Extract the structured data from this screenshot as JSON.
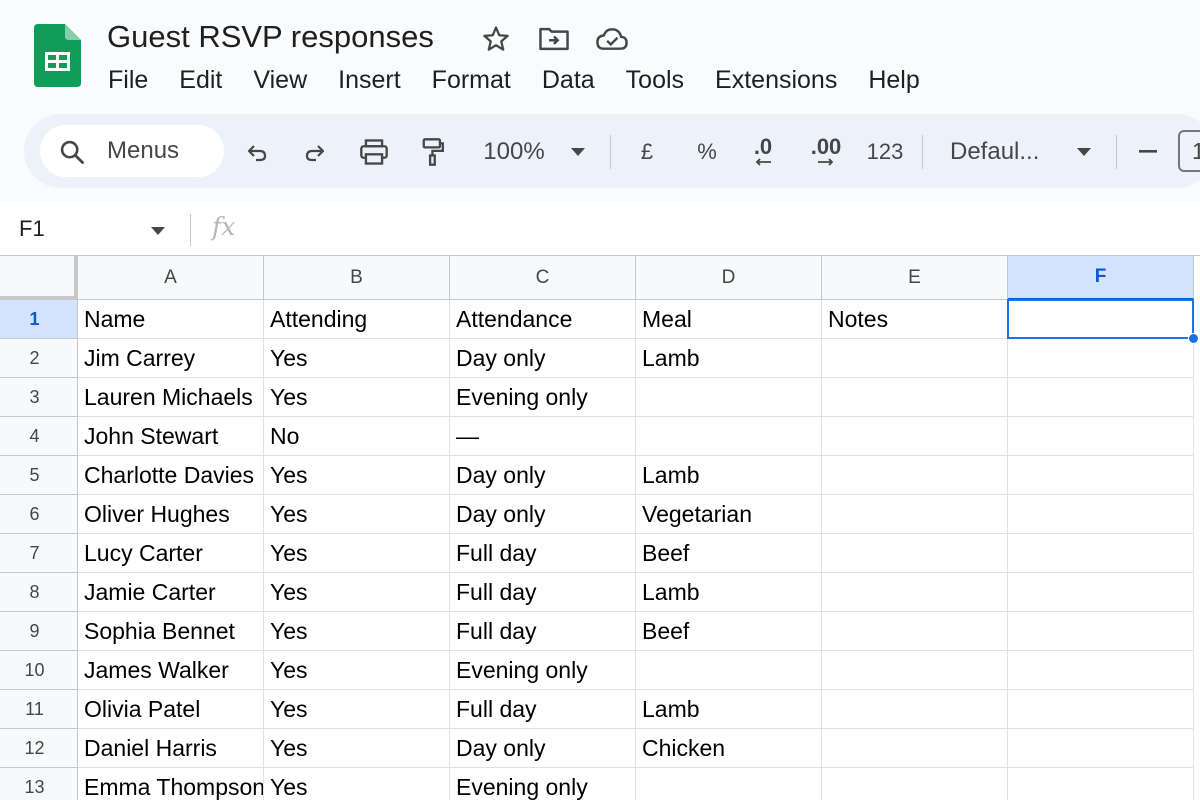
{
  "doc": {
    "title": "Guest RSVP responses"
  },
  "title_icons": [
    "star-icon",
    "move-to-folder-icon",
    "cloud-status-icon"
  ],
  "menu": [
    "File",
    "Edit",
    "View",
    "Insert",
    "Format",
    "Data",
    "Tools",
    "Extensions",
    "Help"
  ],
  "toolbar": {
    "search_label": "Menus",
    "zoom": "100%",
    "currency": "£",
    "percent": "%",
    "decrease_decimals": ".0",
    "increase_decimals": ".00",
    "number_format": "123",
    "font": "Defaul...",
    "font_size": "1"
  },
  "formula_bar": {
    "name_box": "F1",
    "fx": "fx",
    "value": ""
  },
  "columns": [
    "A",
    "B",
    "C",
    "D",
    "E",
    "F"
  ],
  "selected_column": "F",
  "active_cell": "F1",
  "rows": [
    {
      "num": "1",
      "cells": [
        "Name",
        "Attending",
        "Attendance",
        "Meal",
        "Notes",
        ""
      ]
    },
    {
      "num": "2",
      "cells": [
        "Jim Carrey",
        "Yes",
        "Day only",
        "Lamb",
        "",
        ""
      ]
    },
    {
      "num": "3",
      "cells": [
        "Lauren Michaels",
        "Yes",
        "Evening only",
        "",
        "",
        ""
      ]
    },
    {
      "num": "4",
      "cells": [
        "John Stewart",
        "No",
        "—",
        "",
        "",
        ""
      ]
    },
    {
      "num": "5",
      "cells": [
        "Charlotte Davies",
        "Yes",
        "Day only",
        "Lamb",
        "",
        ""
      ]
    },
    {
      "num": "6",
      "cells": [
        "Oliver Hughes",
        "Yes",
        "Day only",
        "Vegetarian",
        "",
        ""
      ]
    },
    {
      "num": "7",
      "cells": [
        "Lucy Carter",
        "Yes",
        "Full day",
        "Beef",
        "",
        ""
      ]
    },
    {
      "num": "8",
      "cells": [
        "Jamie Carter",
        "Yes",
        "Full day",
        "Lamb",
        "",
        ""
      ]
    },
    {
      "num": "9",
      "cells": [
        "Sophia Bennet",
        "Yes",
        "Full day",
        "Beef",
        "",
        ""
      ]
    },
    {
      "num": "10",
      "cells": [
        "James Walker",
        "Yes",
        "Evening only",
        "",
        "",
        ""
      ]
    },
    {
      "num": "11",
      "cells": [
        "Olivia Patel",
        "Yes",
        "Full day",
        "Lamb",
        "",
        ""
      ]
    },
    {
      "num": "12",
      "cells": [
        "Daniel Harris",
        "Yes",
        "Day only",
        "Chicken",
        "",
        ""
      ]
    },
    {
      "num": "13",
      "cells": [
        "Emma Thompson",
        "Yes",
        "Evening only",
        "",
        "",
        ""
      ]
    }
  ],
  "colors": {
    "brand_green": "#0f9d58",
    "selection_blue": "#1a73e8",
    "header_selected_bg": "#d3e3fd"
  }
}
